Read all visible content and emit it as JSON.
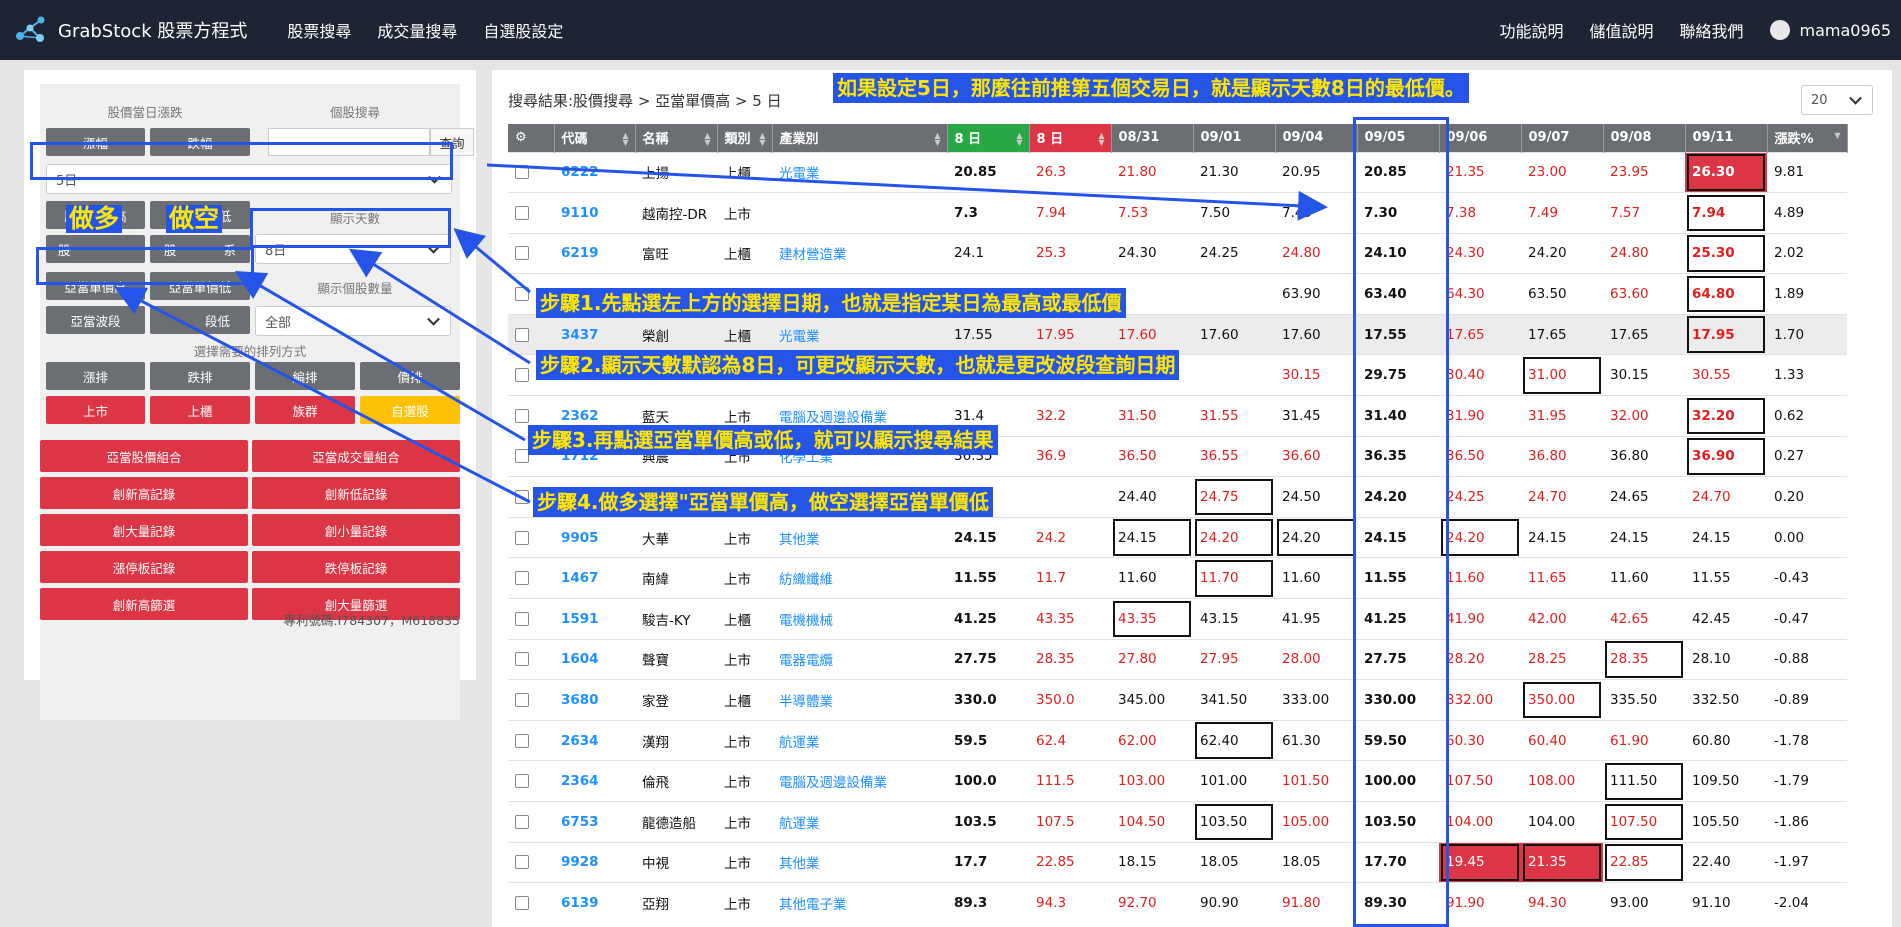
{
  "navbar": {
    "brand": "GrabStock 股票方程式",
    "links": [
      "股票搜尋",
      "成交量搜尋",
      "自選股設定"
    ],
    "right_links": [
      "功能說明",
      "儲值說明",
      "聯絡我們"
    ],
    "user": "mama0965"
  },
  "sidebar": {
    "daily_change_label": "股價當日漲跌",
    "stock_search_label": "個股搜尋",
    "rise_button": "漲幅",
    "fall_button": "跌幅",
    "query_button": "查詢",
    "period_select": "5日",
    "new_high_button": "股價創新高",
    "new_low_button": "股價創新低",
    "display_days_label": "顯示天數",
    "display_days_select": "8日",
    "partial_left": "股",
    "partial_mid": "股",
    "partial_mid_end": "系",
    "single_price_high_button": "亞當單價高",
    "single_price_low_button": "亞當單價低",
    "display_count_label": "顯示個股數量",
    "wave_low_button_part": "亞當波段",
    "wave_low_button_part2": "段低",
    "display_count_select": "全部",
    "sort_label": "選擇需要的排列方式",
    "sort_buttons": [
      "漲排",
      "跌排",
      "編排",
      "價排"
    ],
    "market_buttons": [
      "上市",
      "上櫃",
      "族群",
      "自選股"
    ],
    "combo_buttons": [
      "亞當股價組合",
      "亞當成交量組合",
      "創新高記錄",
      "創新低記錄",
      "創大量記錄",
      "創小量記錄",
      "漲停板記錄",
      "跌停板記錄",
      "創新高篩選",
      "創大量篩選"
    ],
    "patent": "專利號碼:I784307，M618835"
  },
  "results": {
    "breadcrumb": "搜尋結果:股價搜尋 > 亞當單價高 > 5 日",
    "page_size": "20",
    "headers": [
      "代碼",
      "名稱",
      "類別",
      "產業別",
      "8 日",
      "8 日",
      "08/31",
      "09/01",
      "09/04",
      "09/05",
      "09/06",
      "09/07",
      "09/08",
      "09/11",
      "漲跌%"
    ],
    "rows": [
      {
        "code": "6222",
        "name": "上揚",
        "market": "上櫃",
        "industry": "光電業",
        "v": [
          "20.85",
          "26.3",
          "21.80",
          "21.30",
          "20.95",
          "20.85",
          "21.35",
          "23.00",
          "23.95",
          "26.30",
          "9.81"
        ]
      },
      {
        "code": "9110",
        "name": "越南控-DR",
        "market": "上市",
        "industry": "",
        "v": [
          "7.3",
          "7.94",
          "7.53",
          "7.50",
          "7.49",
          "7.30",
          "7.38",
          "7.49",
          "7.57",
          "7.94",
          "4.89"
        ]
      },
      {
        "code": "6219",
        "name": "富旺",
        "market": "上櫃",
        "industry": "建材營造業",
        "v": [
          "24.1",
          "25.3",
          "24.30",
          "24.25",
          "24.80",
          "24.10",
          "24.30",
          "24.20",
          "24.80",
          "25.30",
          "2.02"
        ]
      },
      {
        "code": "",
        "name": "",
        "market": "",
        "industry": "",
        "v": [
          "",
          "",
          "",
          "",
          "63.90",
          "63.40",
          "64.30",
          "63.50",
          "63.60",
          "64.80",
          "1.89"
        ]
      },
      {
        "code": "3437",
        "name": "榮創",
        "market": "上櫃",
        "industry": "光電業",
        "v": [
          "17.55",
          "17.95",
          "17.60",
          "17.60",
          "17.60",
          "17.55",
          "17.65",
          "17.65",
          "17.65",
          "17.95",
          "1.70"
        ]
      },
      {
        "code": "",
        "name": "",
        "market": "",
        "industry": "",
        "v": [
          "",
          "",
          "",
          "",
          "30.15",
          "29.75",
          "30.40",
          "31.00",
          "30.15",
          "30.55",
          "1.33"
        ]
      },
      {
        "code": "2362",
        "name": "藍天",
        "market": "上市",
        "industry": "電腦及週邊設備業",
        "v": [
          "31.4",
          "32.2",
          "31.50",
          "31.55",
          "31.45",
          "31.40",
          "31.90",
          "31.95",
          "32.00",
          "32.20",
          "0.62"
        ]
      },
      {
        "code": "1712",
        "name": "興農",
        "market": "上市",
        "industry": "化學工業",
        "v": [
          "36.35",
          "36.9",
          "36.50",
          "36.55",
          "36.60",
          "36.35",
          "36.50",
          "36.80",
          "36.80",
          "36.90",
          "0.27"
        ]
      },
      {
        "code": "",
        "name": "",
        "market": "",
        "industry": "",
        "v": [
          "",
          "",
          "24.40",
          "24.75",
          "24.50",
          "24.20",
          "24.25",
          "24.70",
          "24.65",
          "24.70",
          "0.20"
        ]
      },
      {
        "code": "9905",
        "name": "大華",
        "market": "上市",
        "industry": "其他業",
        "v": [
          "24.15",
          "24.2",
          "24.15",
          "24.20",
          "24.20",
          "24.15",
          "24.20",
          "24.15",
          "24.15",
          "24.15",
          "0.00"
        ]
      },
      {
        "code": "1467",
        "name": "南緯",
        "market": "上市",
        "industry": "紡織纖維",
        "v": [
          "11.55",
          "11.7",
          "11.60",
          "11.70",
          "11.60",
          "11.55",
          "11.60",
          "11.65",
          "11.60",
          "11.55",
          "-0.43"
        ]
      },
      {
        "code": "1591",
        "name": "駿吉-KY",
        "market": "上櫃",
        "industry": "電機機械",
        "v": [
          "41.25",
          "43.35",
          "43.35",
          "43.15",
          "41.95",
          "41.25",
          "41.90",
          "42.00",
          "42.65",
          "42.45",
          "-0.47"
        ]
      },
      {
        "code": "1604",
        "name": "聲寶",
        "market": "上市",
        "industry": "電器電纜",
        "v": [
          "27.75",
          "28.35",
          "27.80",
          "27.95",
          "28.00",
          "27.75",
          "28.20",
          "28.25",
          "28.35",
          "28.10",
          "-0.88"
        ]
      },
      {
        "code": "3680",
        "name": "家登",
        "market": "上櫃",
        "industry": "半導體業",
        "v": [
          "330.0",
          "350.0",
          "345.00",
          "341.50",
          "333.00",
          "330.00",
          "332.00",
          "350.00",
          "335.50",
          "332.50",
          "-0.89"
        ]
      },
      {
        "code": "2634",
        "name": "漢翔",
        "market": "上市",
        "industry": "航運業",
        "v": [
          "59.5",
          "62.4",
          "62.00",
          "62.40",
          "61.30",
          "59.50",
          "60.30",
          "60.40",
          "61.90",
          "60.80",
          "-1.78"
        ]
      },
      {
        "code": "2364",
        "name": "倫飛",
        "market": "上市",
        "industry": "電腦及週邊設備業",
        "v": [
          "100.0",
          "111.5",
          "103.00",
          "101.00",
          "101.50",
          "100.00",
          "107.50",
          "108.00",
          "111.50",
          "109.50",
          "-1.79"
        ]
      },
      {
        "code": "6753",
        "name": "龍德造船",
        "market": "上市",
        "industry": "航運業",
        "v": [
          "103.5",
          "107.5",
          "104.50",
          "103.50",
          "105.00",
          "103.50",
          "104.00",
          "104.00",
          "107.50",
          "105.50",
          "-1.86"
        ]
      },
      {
        "code": "9928",
        "name": "中視",
        "market": "上市",
        "industry": "其他業",
        "v": [
          "17.7",
          "22.85",
          "18.15",
          "18.05",
          "18.05",
          "17.70",
          "19.45",
          "21.35",
          "22.85",
          "22.40",
          "-1.97"
        ]
      },
      {
        "code": "6139",
        "name": "亞翔",
        "market": "上市",
        "industry": "其他電子業",
        "v": [
          "89.3",
          "94.3",
          "92.70",
          "90.90",
          "91.80",
          "89.30",
          "91.90",
          "94.30",
          "93.00",
          "91.10",
          "-2.04"
        ]
      }
    ]
  },
  "annotations": {
    "top_note": "如果設定5日，那麼往前推第五個交易日，就是顯示天數8日的最低價。",
    "long_label": "做多",
    "short_label": "做空",
    "step1": "步驟1.先點選左上方的選擇日期，也就是指定某日為最高或最低價",
    "step2": "步驟2.顯示天數默認為8日，可更改顯示天數，也就是更改波段查詢日期",
    "step3": "步驟3.再點選亞當單價高或低，就可以顯示搜尋結果",
    "step4": "步驟4.做多選擇\"亞當單價高，做空選擇亞當單價低"
  },
  "colors": {
    "navbar": "#1d2433",
    "annotation_blue": "#2455e8",
    "annotation_text": "#ffe600",
    "up_red": "#e01e1e",
    "button_red": "#dc3545",
    "header_green": "#28a745",
    "link_blue": "#1e90ff"
  }
}
